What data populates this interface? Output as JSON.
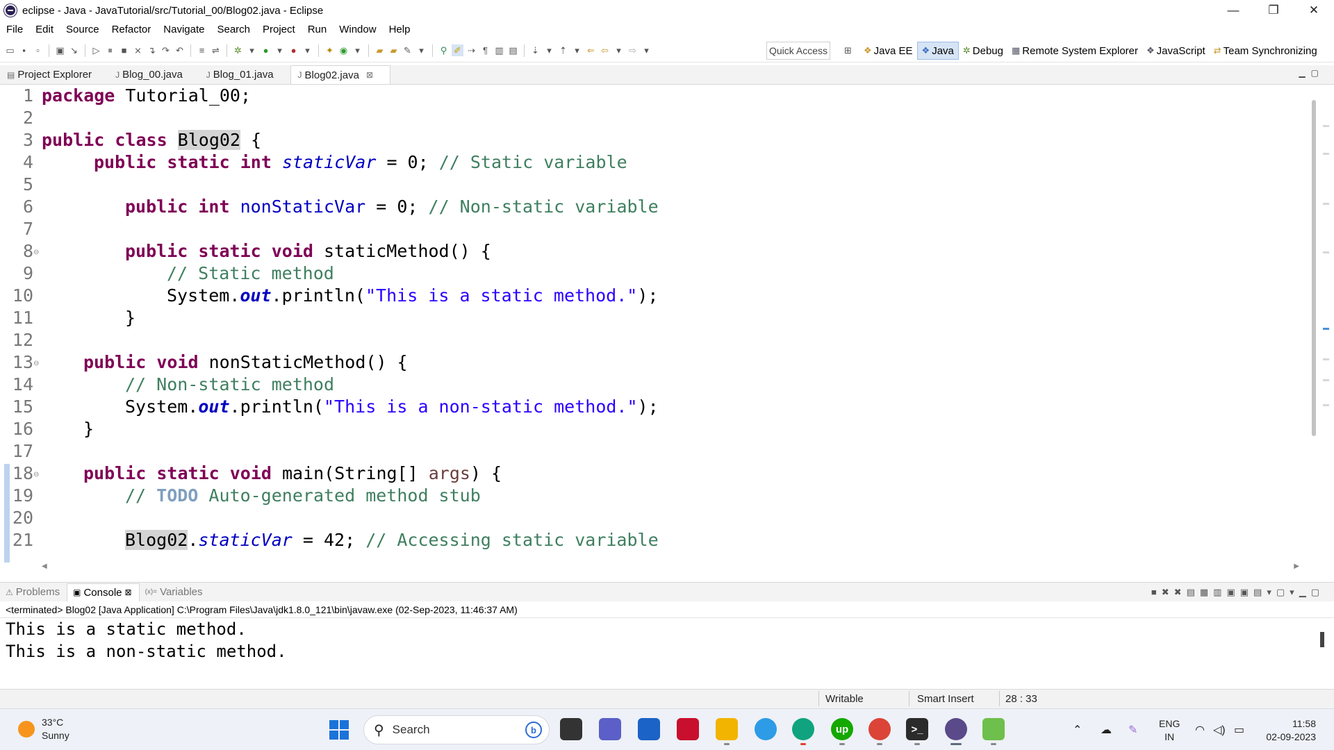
{
  "window": {
    "title": "eclipse - Java - JavaTutorial/src/Tutorial_00/Blog02.java - Eclipse",
    "minimize": "—",
    "restore": "❐",
    "close": "✕"
  },
  "menu": [
    "File",
    "Edit",
    "Source",
    "Refactor",
    "Navigate",
    "Search",
    "Project",
    "Run",
    "Window",
    "Help"
  ],
  "toolbar": {
    "quick_access": "Quick Access",
    "perspectives": [
      {
        "label": "Java EE",
        "icon": "java-ee-perspective-icon"
      },
      {
        "label": "Java",
        "icon": "java-perspective-icon",
        "active": true
      },
      {
        "label": "Debug",
        "icon": "debug-perspective-icon"
      },
      {
        "label": "Remote System Explorer",
        "icon": "remote-system-icon"
      },
      {
        "label": "JavaScript",
        "icon": "javascript-perspective-icon"
      },
      {
        "label": "Team Synchronizing",
        "icon": "team-sync-icon"
      }
    ]
  },
  "editor_tabs": [
    {
      "label": "Project Explorer"
    },
    {
      "label": "Blog_00.java"
    },
    {
      "label": "Blog_01.java"
    },
    {
      "label": "Blog02.java",
      "active": true,
      "close": "⊠"
    }
  ],
  "editor": {
    "line_numbers": [
      "1",
      "2",
      "3",
      "4",
      "5",
      "6",
      "7",
      "8",
      "9",
      "10",
      "11",
      "12",
      "13",
      "14",
      "15",
      "16",
      "17",
      "18",
      "19",
      "20",
      "21"
    ],
    "code": {
      "l1_kw": "package",
      "l1_rest": " Tutorial_00;",
      "l3_kw": "public class",
      "l3_cls": "Blog02",
      "l3_rest": " {",
      "l4_kw": "public static int",
      "l4_var": "staticVar",
      "l4_mid": " = 0; ",
      "l4_cm": "// Static variable",
      "l6_kw": "public int",
      "l6_var": "nonStaticVar",
      "l6_mid": " = 0; ",
      "l6_cm": "// Non-static variable",
      "l8_kw": "public static void",
      "l8_rest": " staticMethod() {",
      "l9_cm": "// Static method",
      "l10_a": "System.",
      "l10_out": "out",
      "l10_b": ".println(",
      "l10_str": "\"This is a static method.\"",
      "l10_c": ");",
      "l11": "}",
      "l13_kw": "public void",
      "l13_rest": " nonStaticMethod() {",
      "l14_cm": "// Non-static method",
      "l15_a": "System.",
      "l15_out": "out",
      "l15_b": ".println(",
      "l15_str": "\"This is a non-static method.\"",
      "l15_c": ");",
      "l16": "}",
      "l18_kw": "public static void",
      "l18_rest": " main(String[] ",
      "l18_param": "args",
      "l18_end": ") {",
      "l19_cm1": "// ",
      "l19_todo": "TODO",
      "l19_cm2": " Auto-generated method stub",
      "l21_cls": "Blog02",
      "l21_dot": ".",
      "l21_var": "staticVar",
      "l21_mid": " = 42; ",
      "l21_cm": "// Accessing static variable"
    }
  },
  "panel": {
    "tabs": [
      {
        "label": "Problems"
      },
      {
        "label": "Console",
        "active": true,
        "close": "⊠"
      },
      {
        "label": "Variables",
        "prefix": "(x)="
      }
    ],
    "header": "<terminated> Blog02 [Java Application] C:\\Program Files\\Java\\jdk1.8.0_121\\bin\\javaw.exe (02-Sep-2023, 11:46:37 AM)",
    "output": [
      "This is a static method.",
      "This is a non-static method."
    ]
  },
  "status": {
    "writable": "Writable",
    "insert_mode": "Smart Insert",
    "position": "28 : 33"
  },
  "taskbar": {
    "weather_temp": "33°C",
    "weather_desc": "Sunny",
    "search_label": "Search",
    "bing": "b",
    "apps": [
      {
        "name": "file-explorer-app",
        "label": "",
        "color": "#f5c342"
      },
      {
        "name": "teams-app",
        "label": "",
        "color": "#5b5fc7"
      },
      {
        "name": "store-app",
        "label": "",
        "color": "#1b63c6"
      },
      {
        "name": "mcafee-app",
        "label": "",
        "color": "#c8102e"
      },
      {
        "name": "folder-app",
        "label": "",
        "color": "#f2b400"
      },
      {
        "name": "copilot-app",
        "label": "",
        "color": "#2d9be6"
      },
      {
        "name": "edge-app",
        "label": "",
        "color": "#0fa37f"
      },
      {
        "name": "upwork-app",
        "label": "up",
        "color": "#14a800"
      },
      {
        "name": "chrome-app",
        "label": "",
        "color": "#db4437"
      },
      {
        "name": "terminal-app",
        "label": ">_",
        "color": "#2b2b2b"
      },
      {
        "name": "eclipse-app",
        "label": "",
        "color": "#5a4a8a"
      },
      {
        "name": "photo-app",
        "label": "",
        "color": "#6fbf4c"
      }
    ],
    "lang_top": "ENG",
    "lang_bottom": "IN",
    "time": "11:58",
    "date": "02-09-2023"
  }
}
